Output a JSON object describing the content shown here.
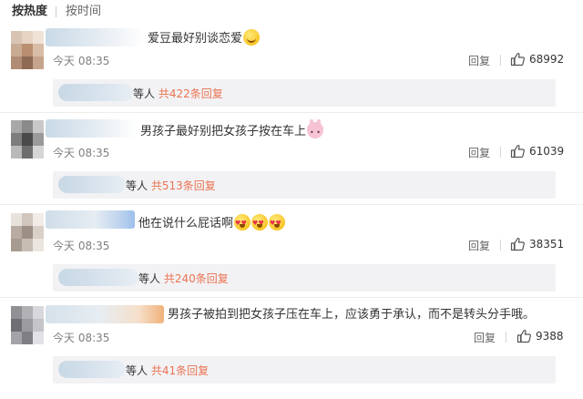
{
  "sort": {
    "hot": "按热度",
    "time": "按时间"
  },
  "comments": [
    {
      "text": "爱豆最好别谈恋爱",
      "emojis": [
        "smile"
      ],
      "time": "今天 08:35",
      "reply_label": "回复",
      "likes": "68992",
      "sub": {
        "prefix": "等人",
        "link": "共422条回复"
      }
    },
    {
      "text": "男孩子最好别把女孩子按在车上",
      "emojis": [
        "bunny"
      ],
      "time": "今天 08:35",
      "reply_label": "回复",
      "likes": "61039",
      "sub": {
        "prefix": "等人",
        "link": "共513条回复"
      }
    },
    {
      "text": "他在说什么屁话啊",
      "emojis": [
        "heart",
        "heart",
        "heart"
      ],
      "time": "今天 08:35",
      "reply_label": "回复",
      "likes": "38351",
      "sub": {
        "prefix": "等人",
        "link": "共240条回复"
      }
    },
    {
      "text": "男孩子被拍到把女孩子压在车上，应该勇于承认，而不是转头分手哦。",
      "emojis": [],
      "time": "今天 08:35",
      "reply_label": "回复",
      "likes": "9388",
      "sub": {
        "prefix": "等人",
        "link": "共41条回复"
      }
    }
  ],
  "colors": {
    "link": "#eb7350",
    "subreply_bg": "#f2f2f5",
    "time": "#808080"
  },
  "icons": {
    "like": "thumbs-up-icon"
  }
}
